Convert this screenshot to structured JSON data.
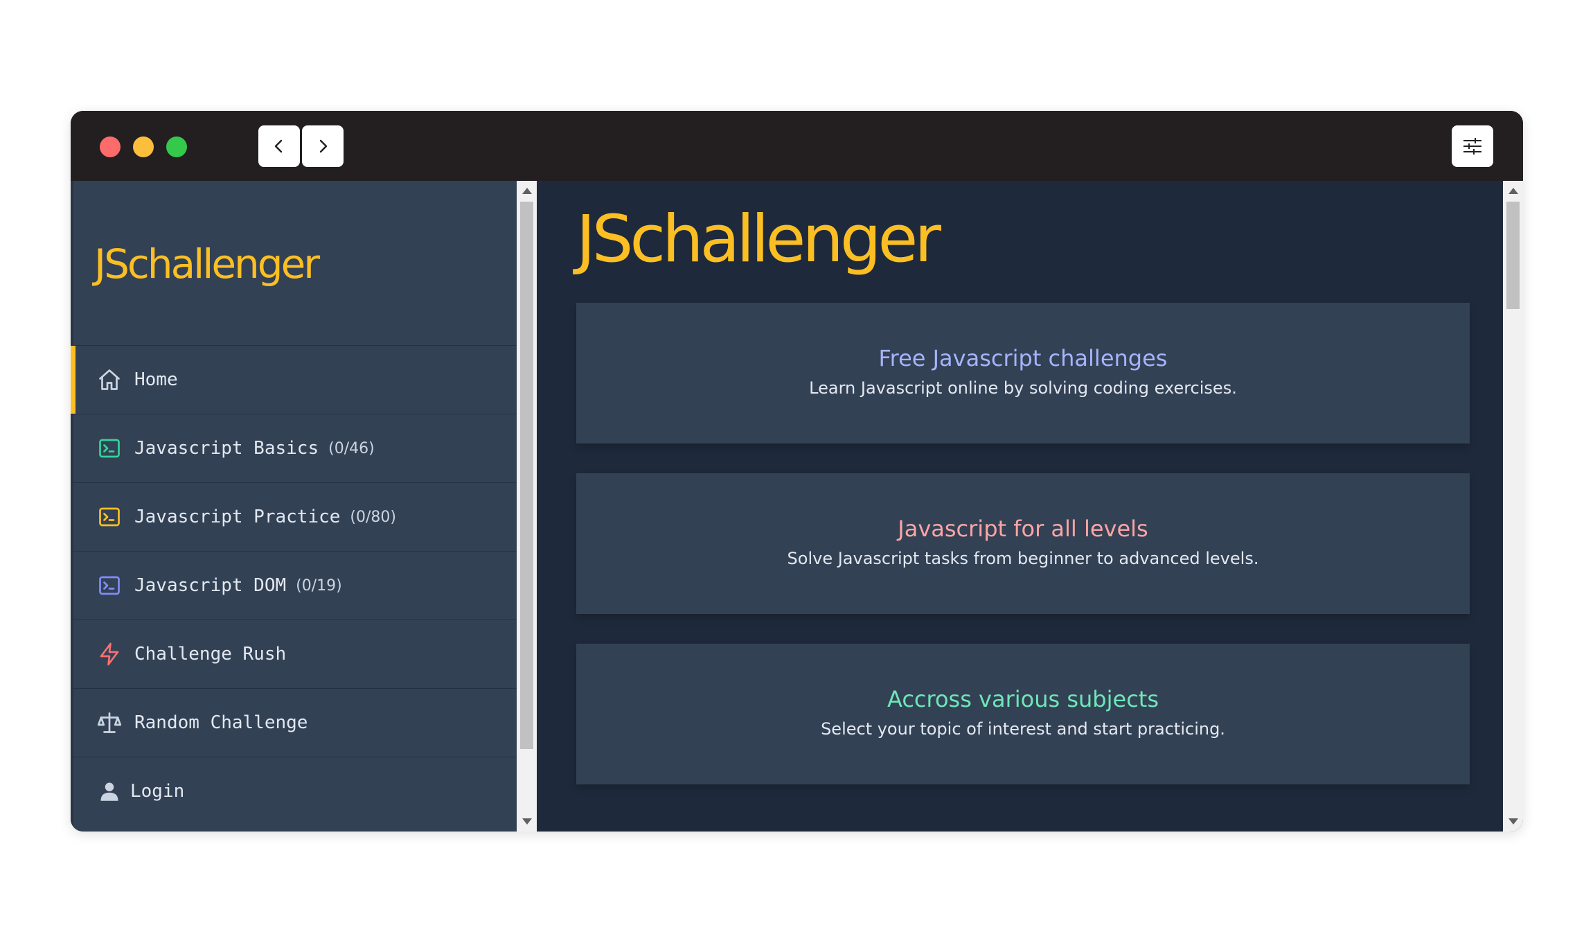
{
  "titlebar": {
    "buttons": [
      "back-icon",
      "forward-icon",
      "settings-sliders-icon"
    ]
  },
  "sidebar": {
    "logo": "JSchallenger",
    "items": [
      {
        "label": "Home",
        "count": "",
        "icon": "home-icon",
        "color": "#cbd5e1",
        "active": true
      },
      {
        "label": "Javascript Basics",
        "count": "(0/46)",
        "icon": "terminal-icon",
        "color": "#34d399",
        "active": false
      },
      {
        "label": "Javascript Practice",
        "count": "(0/80)",
        "icon": "terminal-icon",
        "color": "#fbbf24",
        "active": false
      },
      {
        "label": "Javascript DOM",
        "count": "(0/19)",
        "icon": "terminal-icon",
        "color": "#818cf8",
        "active": false
      },
      {
        "label": "Challenge Rush",
        "count": "",
        "icon": "lightning-icon",
        "color": "#f87171",
        "active": false
      },
      {
        "label": "Random Challenge",
        "count": "",
        "icon": "scale-icon",
        "color": "#cbd5e1",
        "active": false
      },
      {
        "label": "Login",
        "count": "",
        "icon": "user-icon",
        "color": "#cbd5e1",
        "active": false
      }
    ]
  },
  "main": {
    "logo": "JSchallenger",
    "cards": [
      {
        "title": "Free Javascript challenges",
        "subtitle": "Learn Javascript online by solving coding exercises.",
        "color": "#a5b4fc"
      },
      {
        "title": "Javascript for all levels",
        "subtitle": "Solve Javascript tasks from beginner to advanced levels.",
        "color": "#fca5a5"
      },
      {
        "title": "Accross various subjects",
        "subtitle": "Select your topic of interest and start practicing.",
        "color": "#6ee7b7"
      }
    ]
  },
  "colors": {
    "brand": "#fbbf24",
    "sidebar_bg": "#334155",
    "main_bg": "#1e293b",
    "titlebar_bg": "#231f20"
  }
}
